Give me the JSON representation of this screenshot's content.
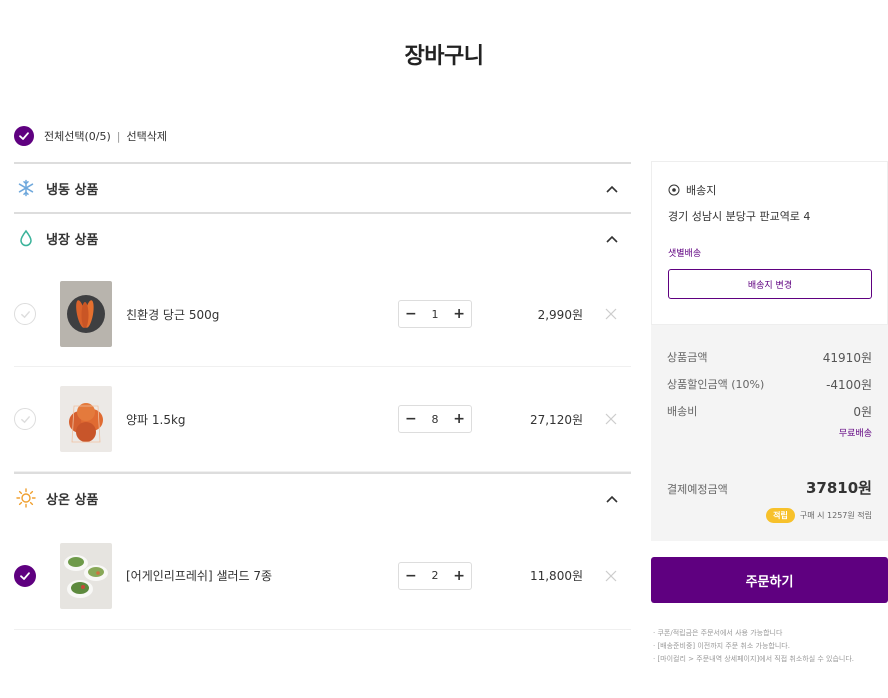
{
  "page": {
    "title": "장바구니"
  },
  "select": {
    "all_label": "전체선택(0/5)",
    "separator": "|",
    "delete_label": "선택삭제"
  },
  "categories": [
    {
      "label": "냉동 상품",
      "icon": "snowflake-icon"
    },
    {
      "label": "냉장 상품",
      "icon": "water-drop-icon"
    },
    {
      "label": "상온 상품",
      "icon": "sun-icon"
    }
  ],
  "items": [
    {
      "name": "친환경 당근 500g",
      "qty": "1",
      "price": "2,990원",
      "checked": false
    },
    {
      "name": "양파 1.5kg",
      "qty": "8",
      "price": "27,120원",
      "checked": false
    },
    {
      "name": "[어게인리프레쉬] 샐러드 7종",
      "qty": "2",
      "price": "11,800원",
      "checked": true
    }
  ],
  "stepper": {
    "minus": "−",
    "plus": "+"
  },
  "delivery": {
    "heading": "배송지",
    "address": "경기 성남시 분당구 판교역로 4",
    "type": "샛별배송",
    "change_label": "배송지 변경"
  },
  "summary": {
    "product_label": "상품금액",
    "product_value": "41910원",
    "discount_label": "상품할인금액 (10%)",
    "discount_value": "-4100원",
    "shipping_label": "배송비",
    "shipping_value": "0원",
    "free_shipping": "무료배송",
    "total_label": "결제예정금액",
    "total_value": "37810원",
    "reward_badge": "적립",
    "reward_text": "구매 시 1257원 적립"
  },
  "order": {
    "label": "주문하기"
  },
  "notes": [
    "· 쿠폰/적립금은 주문서에서 사용 가능합니다",
    "· [배송준비중] 이전까지 주문 취소 가능합니다.",
    "· [마이컬리 > 주문내역 상세페이지]에서 직접 취소하실 수 있습니다."
  ],
  "colors": {
    "brand": "#5f0080",
    "badge": "#f7c12b"
  }
}
